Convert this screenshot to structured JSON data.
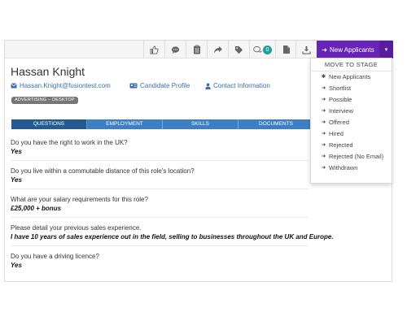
{
  "toolbar": {
    "comment_count": "0",
    "stage_button_label": "New Applicants",
    "icons": [
      "thumbs-up-icon",
      "comment-icon",
      "clipboard-icon",
      "share-icon",
      "tag-icon",
      "comments-icon",
      "document-icon",
      "download-icon"
    ]
  },
  "candidate": {
    "name": "Hassan Knight",
    "email": "Hassan.Knight@fusiontest.com",
    "profile_link": "Candidate Profile",
    "contact_link": "Contact Information",
    "tag": "ADVERTISING – DESKTOP"
  },
  "tabs": [
    {
      "label": "QUESTIONS",
      "active": true
    },
    {
      "label": "EMPLOYMENT",
      "active": false
    },
    {
      "label": "SKILLS",
      "active": false
    },
    {
      "label": "DOCUMENTS",
      "active": false
    }
  ],
  "questions": [
    {
      "q": "Do you have the right to work in the UK?",
      "a": "Yes"
    },
    {
      "q": "Do you live within a commutable distance of this role's location?",
      "a": "Yes"
    },
    {
      "q": "What are your salary requirements for this role?",
      "a": "£25,000 + bonus"
    },
    {
      "q": "Please detail your previous sales experience.",
      "a": "I have 10 years of sales experience out in the field, selling to businesses throughout the UK and Europe."
    },
    {
      "q": "Do you have a driving licence?",
      "a": "Yes"
    }
  ],
  "dropdown": {
    "header": "MOVE TO STAGE",
    "items": [
      {
        "label": "New Applicants",
        "icon": "asterisk-icon",
        "glyph": "✱"
      },
      {
        "label": "Shortlist",
        "icon": "arrow-right-icon",
        "glyph": "➜"
      },
      {
        "label": "Possible",
        "icon": "arrow-right-icon",
        "glyph": "➜"
      },
      {
        "label": "Interview",
        "icon": "arrow-right-icon",
        "glyph": "➜"
      },
      {
        "label": "Offered",
        "icon": "arrow-right-icon",
        "glyph": "➜"
      },
      {
        "label": "Hired",
        "icon": "arrow-right-icon",
        "glyph": "➜"
      },
      {
        "label": "Rejected",
        "icon": "arrow-right-icon",
        "glyph": "➜"
      },
      {
        "label": "Rejected (No Email)",
        "icon": "arrow-right-icon",
        "glyph": "➜"
      },
      {
        "label": "Withdrawn",
        "icon": "arrow-right-icon",
        "glyph": "➜"
      }
    ]
  },
  "colors": {
    "accent_purple": "#6a23b7",
    "tab_blue": "#3d7fc4",
    "tab_active": "#235a91",
    "link_blue": "#3b6ea5",
    "badge_teal": "#1aa198"
  }
}
